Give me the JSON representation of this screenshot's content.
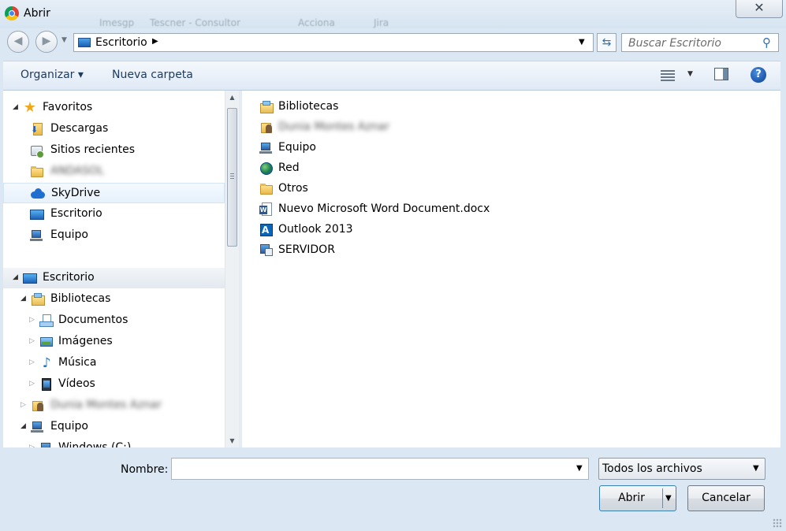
{
  "window": {
    "title": "Abrir",
    "close_glyph": "✕",
    "background_tab_labels": [
      "Imesgp",
      "Tescner - Consultor",
      "Acciona",
      "Jira"
    ]
  },
  "nav": {
    "back_icon": "back-arrow-icon",
    "forward_icon": "forward-arrow-icon",
    "address": {
      "location": "Escritorio"
    },
    "search": {
      "placeholder": "Buscar Escritorio"
    }
  },
  "toolbar": {
    "organize_label": "Organizar ▾",
    "new_folder_label": "Nueva carpeta",
    "help_glyph": "?"
  },
  "sidebar": {
    "favorites": {
      "label": "Favoritos",
      "items": [
        {
          "label": "Descargas"
        },
        {
          "label": "Sitios recientes"
        },
        {
          "label": "ANDASOL"
        },
        {
          "label": "SkyDrive"
        },
        {
          "label": "Escritorio"
        },
        {
          "label": "Equipo"
        }
      ]
    },
    "desktop_tree": {
      "label": "Escritorio",
      "libraries": {
        "label": "Bibliotecas",
        "items": [
          {
            "label": "Documentos"
          },
          {
            "label": "Imágenes"
          },
          {
            "label": "Música"
          },
          {
            "label": "Vídeos"
          }
        ]
      },
      "user": {
        "label": "Dunia Montes Aznar"
      },
      "computer": {
        "label": "Equipo"
      },
      "drive": {
        "label": "Windows (C:)"
      }
    }
  },
  "files": [
    {
      "name": "Bibliotecas",
      "icon": "library-icon"
    },
    {
      "name": "Dunia Montes Aznar",
      "icon": "user-folder-icon"
    },
    {
      "name": "Equipo",
      "icon": "computer-icon"
    },
    {
      "name": "Red",
      "icon": "network-icon"
    },
    {
      "name": "Otros",
      "icon": "folder-icon"
    },
    {
      "name": "Nuevo Microsoft Word Document.docx",
      "icon": "word-document-icon"
    },
    {
      "name": "Outlook 2013",
      "icon": "outlook-icon"
    },
    {
      "name": "SERVIDOR",
      "icon": "server-shortcut-icon"
    }
  ],
  "bottom": {
    "name_label": "Nombre:",
    "name_value": "",
    "filter_value": "Todos los archivos",
    "open_label": "Abrir",
    "cancel_label": "Cancelar"
  },
  "colors": {
    "chrome_background": "#dbe8f3",
    "toolbar_text": "#1e3a5c",
    "accent": "#1f6fd1"
  }
}
